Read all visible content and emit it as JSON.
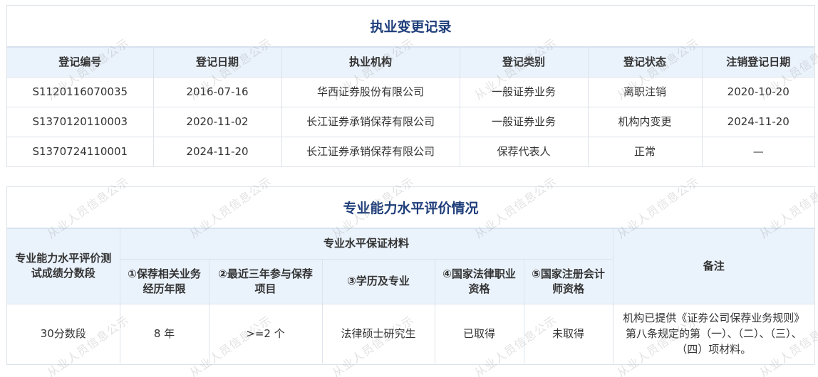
{
  "records": {
    "title": "执业变更记录",
    "columns": [
      "登记编号",
      "登记日期",
      "执业机构",
      "登记类别",
      "登记状态",
      "注销登记日期"
    ],
    "rows": [
      [
        "S1120116070035",
        "2016-07-16",
        "华西证券股份有限公司",
        "一般证券业务",
        "离职注销",
        "2020-10-20"
      ],
      [
        "S1370120110003",
        "2020-11-02",
        "长江证券承销保荐有限公司",
        "一般证券业务",
        "机构内变更",
        "2024-11-20"
      ],
      [
        "S1370724110001",
        "2024-11-20",
        "长江证券承销保荐有限公司",
        "保荐代表人",
        "正常",
        "—"
      ]
    ]
  },
  "ability": {
    "title": "专业能力水平评价情况",
    "score_header": "专业能力水平评价测试成绩分数段",
    "materials_header": "专业水平保证材料",
    "material_columns": [
      "①保荐相关业务经历年限",
      "②最近三年参与保荐项目",
      "③学历及专业",
      "④国家法律职业资格",
      "⑤国家注册会计师资格"
    ],
    "remark_header": "备注",
    "row": {
      "score": "30分数段",
      "years": "8 年",
      "projects": ">=2 个",
      "education": "法律硕士研究生",
      "law_qualification": "已取得",
      "cpa_qualification": "未取得",
      "remark": "机构已提供《证券公司保荐业务规则》第八条规定的第（一）、（二）、（三）、（四）项材料。"
    }
  },
  "watermark": {
    "text": "从业人员信息公示"
  }
}
